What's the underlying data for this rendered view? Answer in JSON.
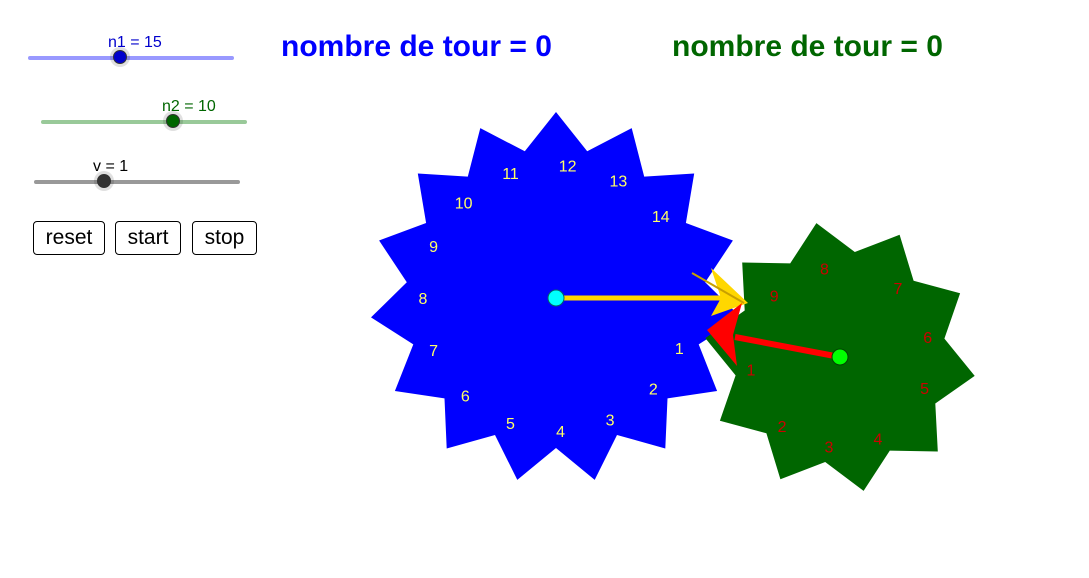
{
  "sliders": [
    {
      "id": "n1",
      "label": "n1 = 15",
      "value": 15,
      "min": 5,
      "max": 25,
      "track_color": "#9999ff",
      "knob_color": "#0000cc",
      "label_color": "#0000cc"
    },
    {
      "id": "n2",
      "label": "n2 = 10",
      "value": 10,
      "min": 5,
      "max": 15,
      "track_color": "#99c999",
      "knob_color": "#006600",
      "label_color": "#006600"
    },
    {
      "id": "v",
      "label": "v = 1",
      "value": 1,
      "min": 0,
      "max": 5,
      "track_color": "#999999",
      "knob_color": "#333333",
      "label_color": "#000000"
    }
  ],
  "buttons": {
    "reset": "reset",
    "start": "start",
    "stop": "stop"
  },
  "counters": {
    "blue": "nombre de tour = 0",
    "green": "nombre de tour = 0"
  },
  "gears": {
    "blue": {
      "teeth": 15,
      "color": "#0000ff",
      "label_color": "#ffff66",
      "labels": [
        "1",
        "2",
        "3",
        "4",
        "5",
        "6",
        "7",
        "8",
        "9",
        "10",
        "11",
        "12",
        "13",
        "14"
      ],
      "center_color": "#00ffff"
    },
    "green": {
      "teeth": 10,
      "color": "#006600",
      "label_color": "#cc0000",
      "labels": [
        "1",
        "2",
        "3",
        "4",
        "5",
        "6",
        "7",
        "8",
        "9"
      ],
      "center_color": "#00ff00"
    }
  },
  "colors": {
    "blue_text": "#0000ff",
    "green_text": "#006600",
    "yellow_hand": "#ffd700",
    "red_hand": "#ff0000"
  }
}
